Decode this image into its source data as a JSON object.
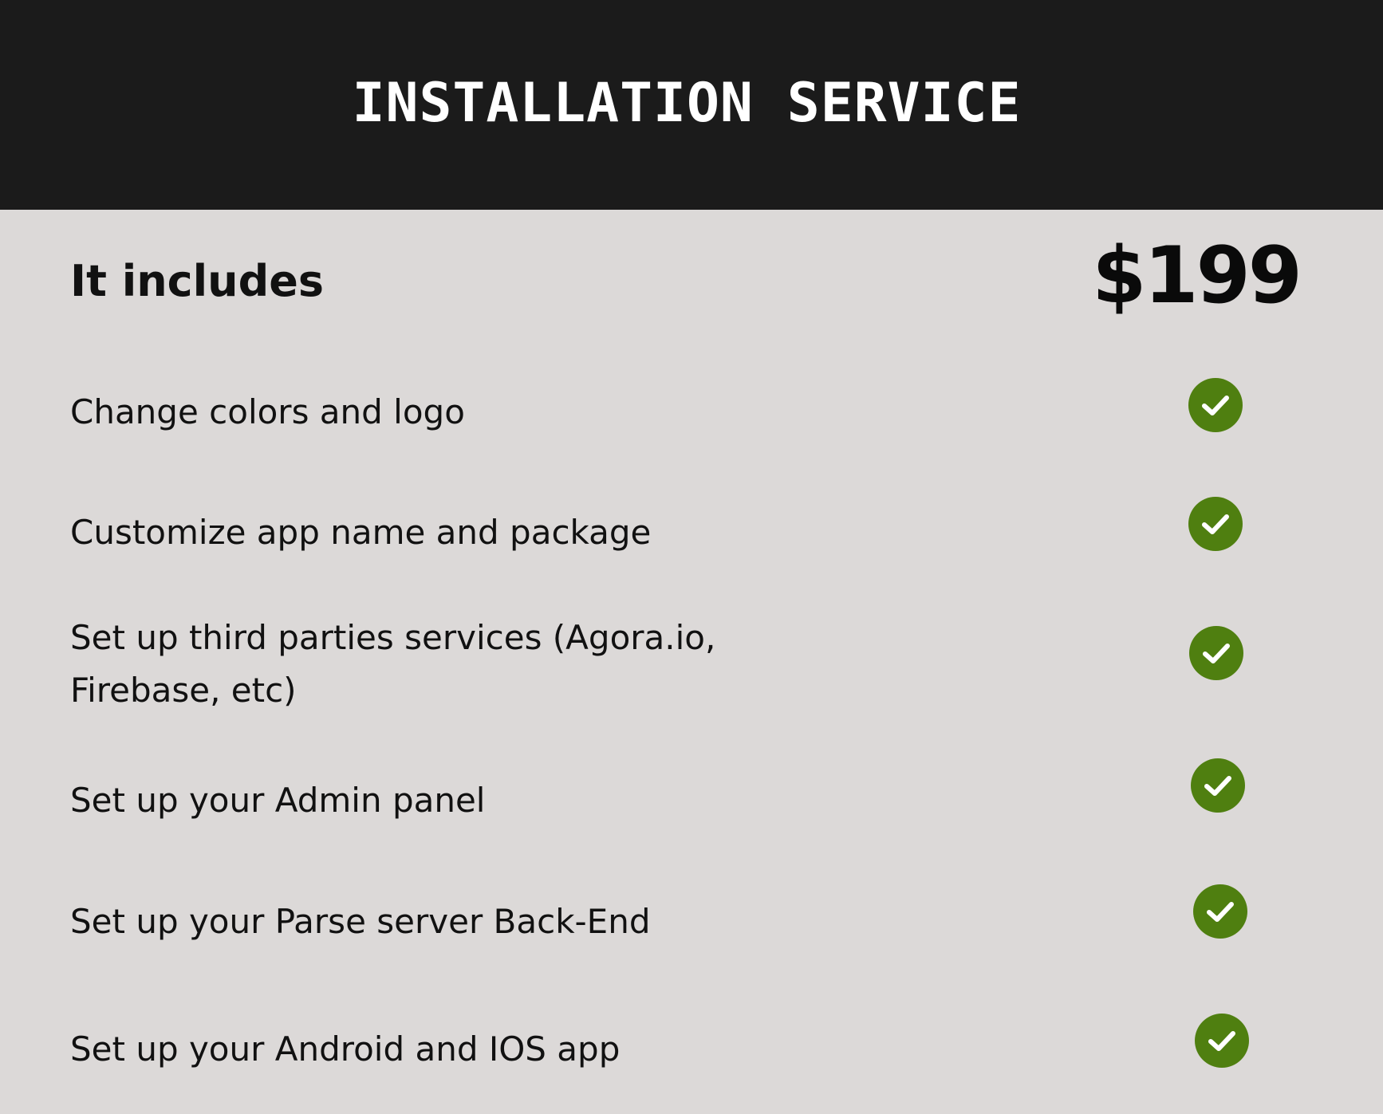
{
  "header": {
    "title": "INSTALLATION SERVICE"
  },
  "summary": {
    "heading": "It includes",
    "price": "$199"
  },
  "features": [
    {
      "label": "Change colors and logo",
      "included": true
    },
    {
      "label": "Customize app name and package",
      "included": true
    },
    {
      "label": "Set up third parties services (Agora.io, Firebase, etc)",
      "included": true
    },
    {
      "label": "Set up your Admin panel",
      "included": true
    },
    {
      "label": "Set up your Parse server Back-End",
      "included": true
    },
    {
      "label": "Set up your Android and IOS app",
      "included": true
    }
  ],
  "colors": {
    "header_bg": "#1b1b1b",
    "body_bg": "#dcd9d8",
    "check_bg": "#4f7f10",
    "check_mark": "#ffffff"
  },
  "icons": {
    "included": "check-circle-icon"
  }
}
